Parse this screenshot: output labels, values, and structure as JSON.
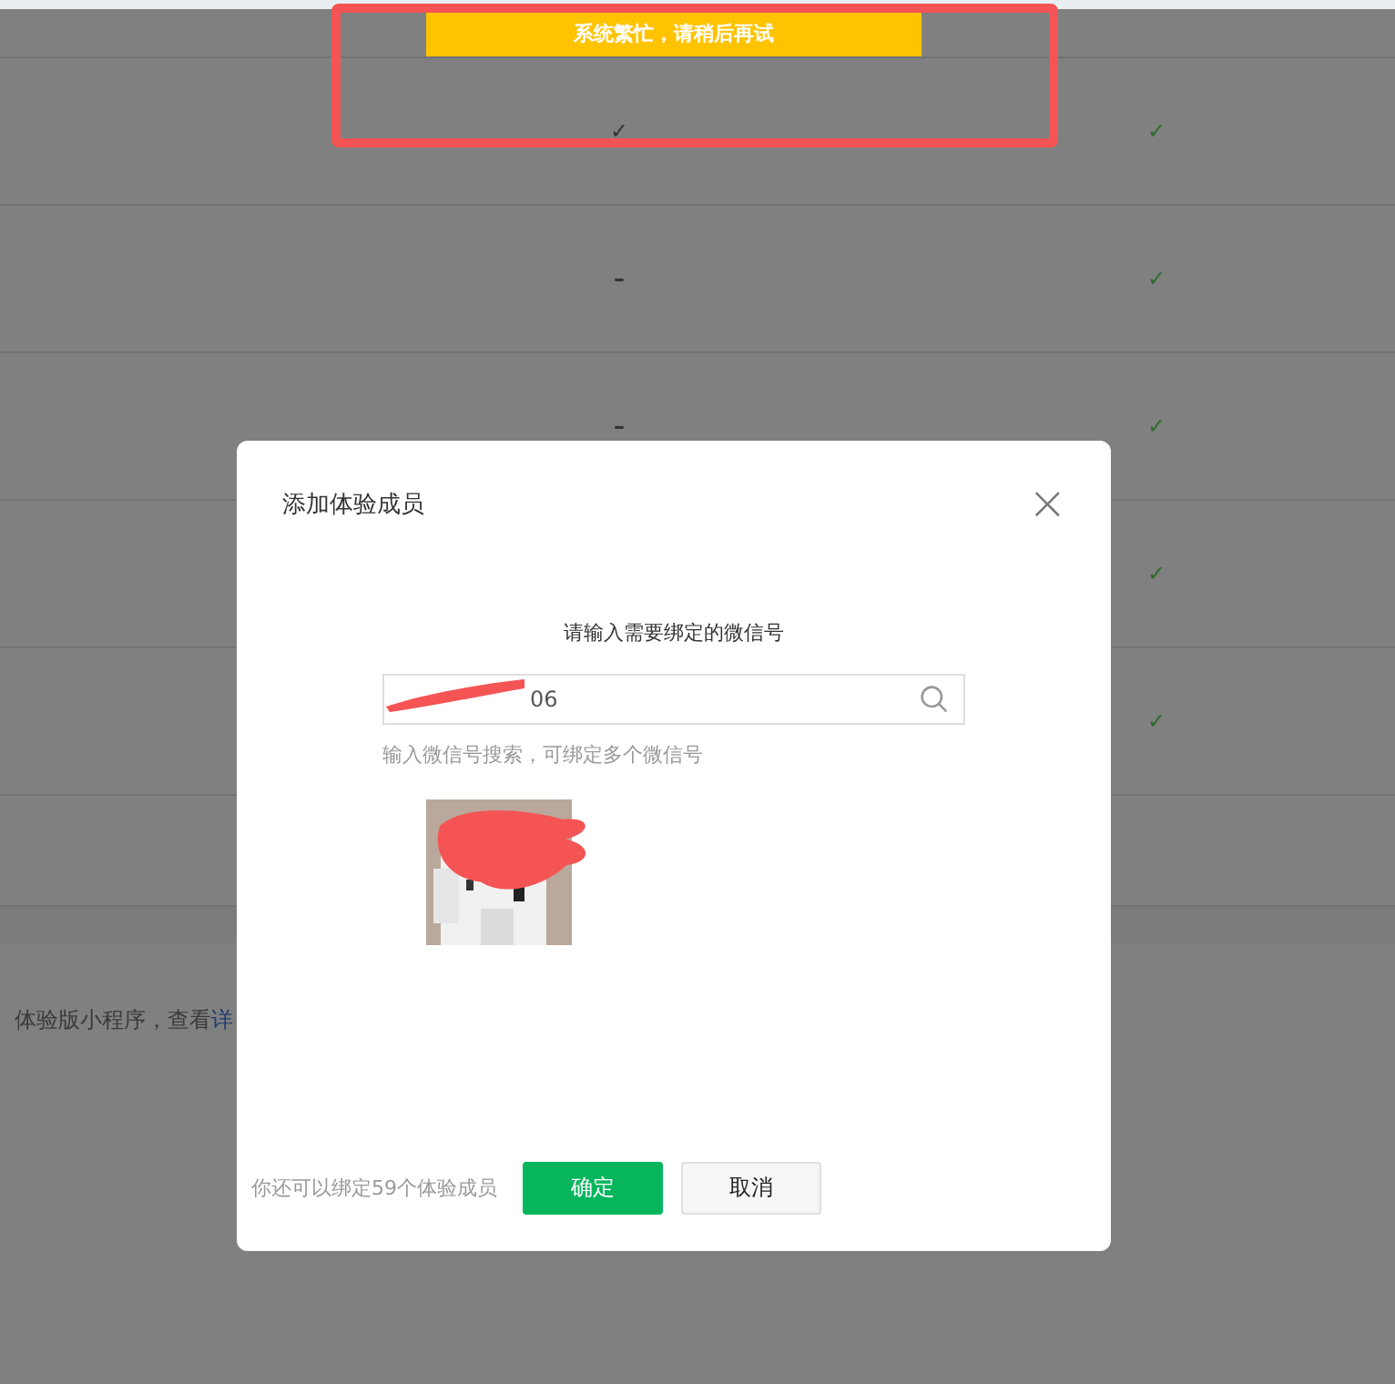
{
  "toast": {
    "text": "系统繁忙，请稍后再试"
  },
  "table": {
    "rows": [
      {
        "column_2": "✓",
        "column_4": "✓"
      },
      {
        "column_2": "–",
        "column_4": "✓"
      },
      {
        "column_2": "–",
        "column_4": "✓"
      },
      {
        "column_4": "✓"
      },
      {
        "column_4": "✓"
      }
    ]
  },
  "note": {
    "text": "体验版小程序，查看",
    "link": "详"
  },
  "dialog": {
    "title": "添加体验成员",
    "close": "×",
    "prompt": "请输入需要绑定的微信号",
    "search": {
      "value": "06"
    },
    "hint": "输入微信号搜索，可绑定多个微信号",
    "remaining": "你还可以绑定59个体验成员",
    "buttons": [
      {
        "label": "确定",
        "kind": "primary"
      },
      {
        "label": "取消",
        "kind": "default"
      }
    ]
  }
}
